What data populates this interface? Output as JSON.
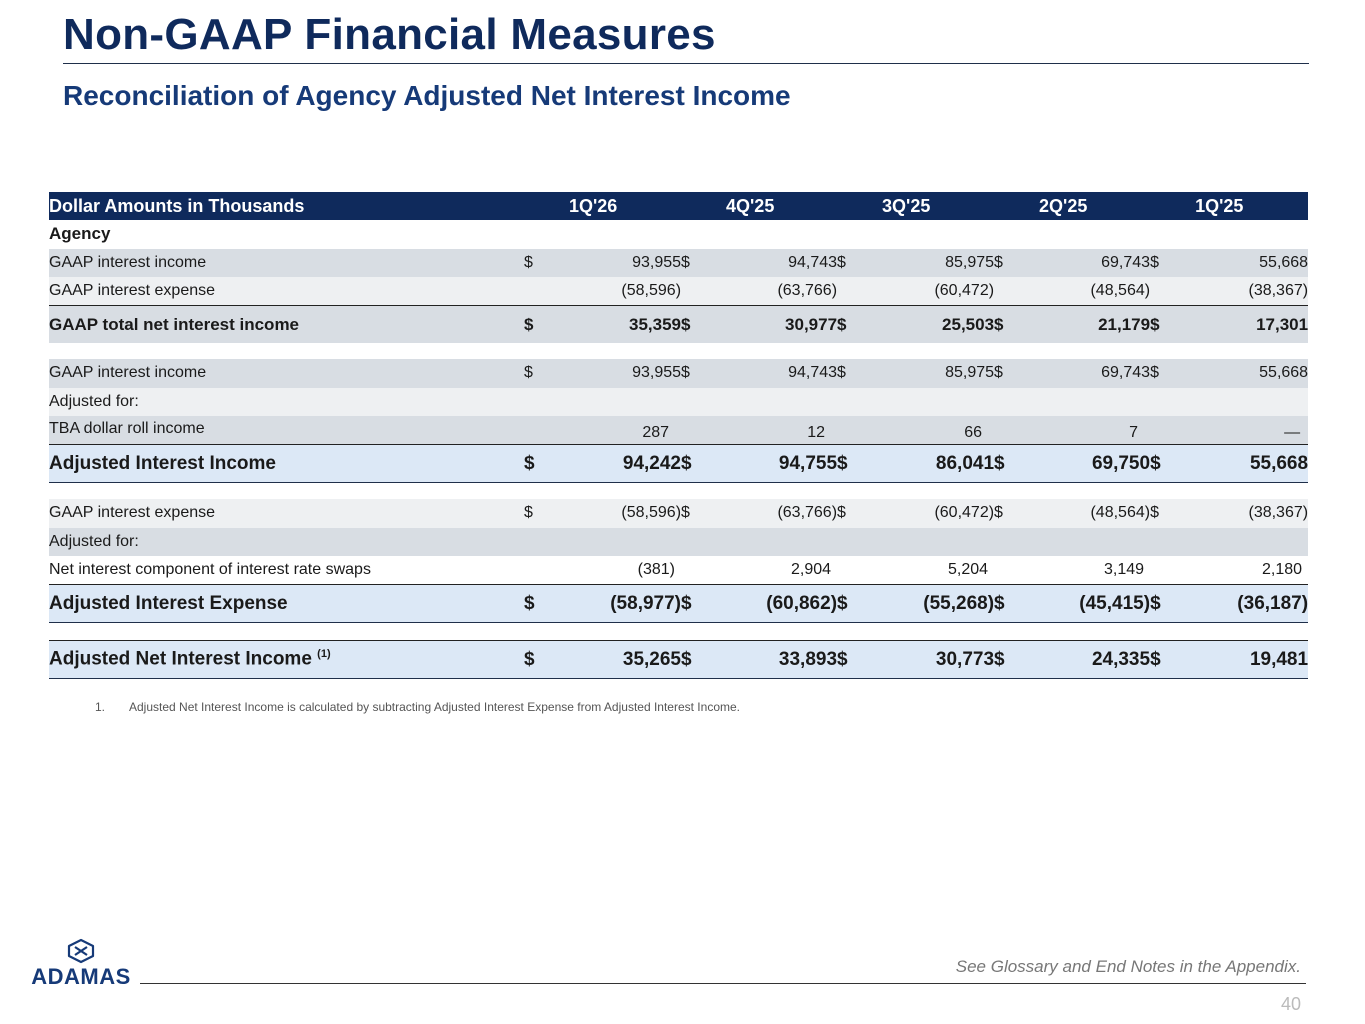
{
  "header": {
    "title": "Non-GAAP Financial Measures",
    "subtitle": "Reconciliation of Agency Adjusted Net Interest Income"
  },
  "table": {
    "header_label": "Dollar Amounts in Thousands",
    "columns": [
      "1Q'26",
      "4Q'25",
      "3Q'25",
      "2Q'25",
      "1Q'25"
    ],
    "section_label": "Agency",
    "rows": [
      {
        "label": "GAAP interest income",
        "cur": [
          "$",
          "$",
          "$",
          "$",
          "$"
        ],
        "values": [
          "93,955",
          "94,743",
          "85,975",
          "69,743",
          "55,668"
        ]
      },
      {
        "label": "GAAP interest expense",
        "cur": [
          "",
          "",
          "",
          "",
          ""
        ],
        "values": [
          "(58,596)",
          "(63,766)",
          "(60,472)",
          "(48,564)",
          "(38,367)"
        ]
      },
      {
        "label": "GAAP total net interest income",
        "cur": [
          "$",
          "$",
          "$",
          "$",
          "$"
        ],
        "values": [
          "35,359",
          "30,977",
          "25,503",
          "21,179",
          "17,301"
        ]
      },
      {
        "label": "GAAP interest income",
        "cur": [
          "$",
          "$",
          "$",
          "$",
          "$"
        ],
        "values": [
          "93,955",
          "94,743",
          "85,975",
          "69,743",
          "55,668"
        ]
      },
      {
        "label": "Adjusted for:"
      },
      {
        "label": "TBA dollar roll income",
        "cur": [
          "",
          "",
          "",
          "",
          ""
        ],
        "values": [
          "287",
          "12",
          "66",
          "7",
          "—"
        ]
      },
      {
        "label": "Adjusted Interest Income",
        "cur": [
          "$",
          "$",
          "$",
          "$",
          "$"
        ],
        "values": [
          "94,242",
          "94,755",
          "86,041",
          "69,750",
          "55,668"
        ]
      },
      {
        "label": "GAAP interest expense",
        "cur": [
          "$",
          "$",
          "$",
          "$",
          "$"
        ],
        "values": [
          "(58,596)",
          "(63,766)",
          "(60,472)",
          "(48,564)",
          "(38,367)"
        ]
      },
      {
        "label": "Adjusted for:"
      },
      {
        "label": "Net interest component of interest rate swaps",
        "cur": [
          "",
          "",
          "",
          "",
          ""
        ],
        "values": [
          "(381)",
          "2,904",
          "5,204",
          "3,149",
          "2,180"
        ]
      },
      {
        "label": "Adjusted Interest Expense",
        "cur": [
          "$",
          "$",
          "$",
          "$",
          "$"
        ],
        "values": [
          "(58,977)",
          "(60,862)",
          "(55,268)",
          "(45,415)",
          "(36,187)"
        ]
      },
      {
        "label": "Adjusted Net Interest Income",
        "footnote_ref": "(1)",
        "cur": [
          "$",
          "$",
          "$",
          "$",
          "$"
        ],
        "values": [
          "35,265",
          "33,893",
          "30,773",
          "24,335",
          "19,481"
        ]
      }
    ]
  },
  "footnote": {
    "number": "1.",
    "text": "Adjusted Net Interest Income is calculated by subtracting Adjusted Interest Expense from Adjusted Interest Income."
  },
  "footer": {
    "logo_text": "ADAMAS",
    "glossary_note": "See Glossary and End Notes in the Appendix.",
    "page_number": "40"
  },
  "colors": {
    "navy": "#0f2a5c",
    "title_blue": "#163a78",
    "row_gray": "#d8dde3",
    "row_light": "#eef0f2",
    "highlight_blue": "#dce8f6"
  }
}
